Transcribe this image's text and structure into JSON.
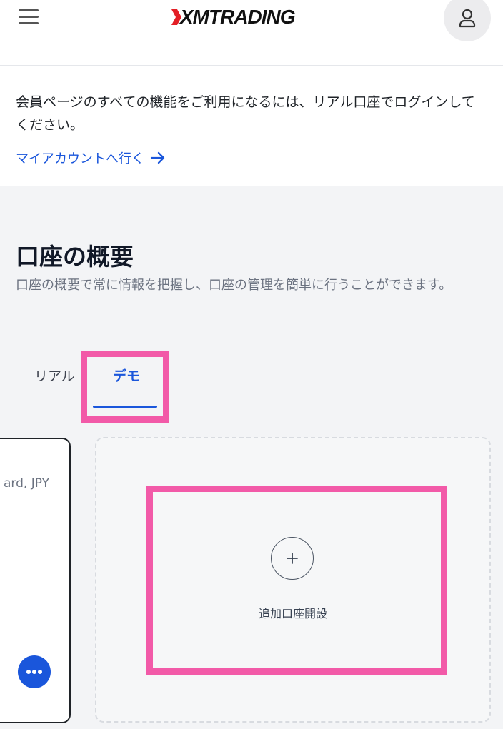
{
  "header": {
    "logo_text": "XMTRADING",
    "brand_color": "#e31f26",
    "menu_icon": "hamburger-icon",
    "user_icon": "user-icon"
  },
  "notice": {
    "message": "会員ページのすべての機能をご利用になるには、リアル口座でログインしてください。",
    "link_label": "マイアカウントへ行く",
    "link_icon": "arrow-right-icon",
    "link_color": "#1a56db"
  },
  "overview": {
    "title": "口座の概要",
    "description": "口座の概要で常に情報を把握し、口座の管理を簡単に行うことができます。"
  },
  "tabs": {
    "real_label": "リアル",
    "demo_label": "デモ",
    "active": "デモ"
  },
  "account_card": {
    "type_text": "ard, JPY",
    "menu_icon": "more-horizontal-icon"
  },
  "add_account": {
    "icon": "plus-icon",
    "label": "追加口座開設"
  },
  "colors": {
    "accent": "#1a56db",
    "highlight": "#f25aa8"
  }
}
